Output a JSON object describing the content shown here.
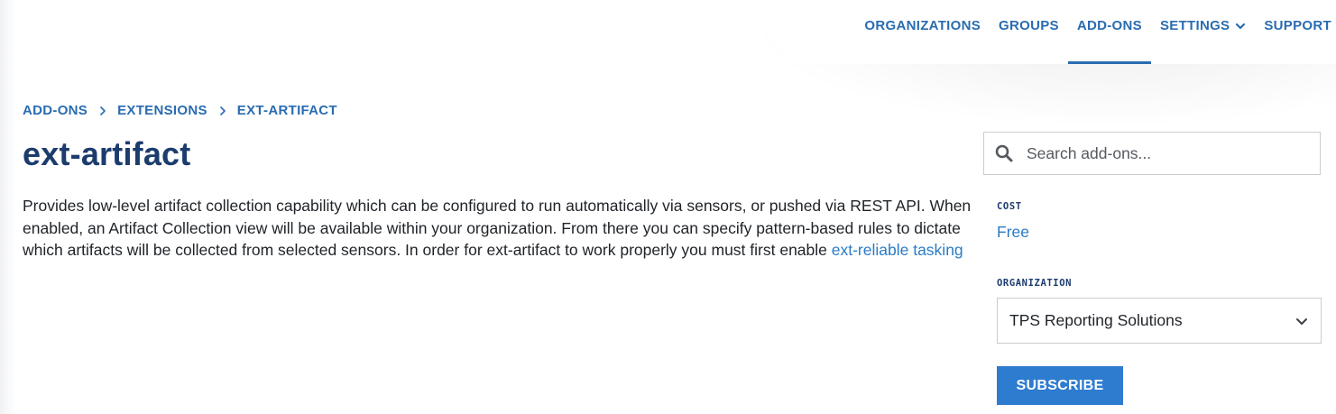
{
  "nav": {
    "items": [
      {
        "label": "ORGANIZATIONS",
        "active": false,
        "dropdown": false
      },
      {
        "label": "GROUPS",
        "active": false,
        "dropdown": false
      },
      {
        "label": "ADD-ONS",
        "active": true,
        "dropdown": false
      },
      {
        "label": "SETTINGS",
        "active": false,
        "dropdown": true
      },
      {
        "label": "SUPPORT",
        "active": false,
        "dropdown": true
      }
    ]
  },
  "breadcrumb": [
    "ADD-ONS",
    "EXTENSIONS",
    "EXT-ARTIFACT"
  ],
  "page": {
    "title": "ext-artifact",
    "description": "Provides low-level artifact collection capability which can be configured to run automatically via sensors, or pushed via REST API. When enabled, an Artifact Collection view will be available within your organization. From there you can specify pattern-based rules to dictate which artifacts will be collected from selected sensors. In order for ext-artifact to work properly you must first enable ",
    "description_link": "ext-reliable tasking"
  },
  "sidebar": {
    "search_placeholder": "Search add-ons...",
    "cost_label": "COST",
    "cost_value": "Free",
    "organization_label": "ORGANIZATION",
    "organization_value": "TPS Reporting Solutions",
    "subscribe_label": "SUBSCRIBE"
  },
  "icons": {
    "search": "search-icon",
    "chevron": "chevron-down-icon",
    "breadcrumb_separator": "chevron-right-icon"
  },
  "colors": {
    "accent": "#2a6cb0",
    "title": "#1c3c6e",
    "link": "#2a7bc6",
    "button": "#2e7ccf"
  }
}
